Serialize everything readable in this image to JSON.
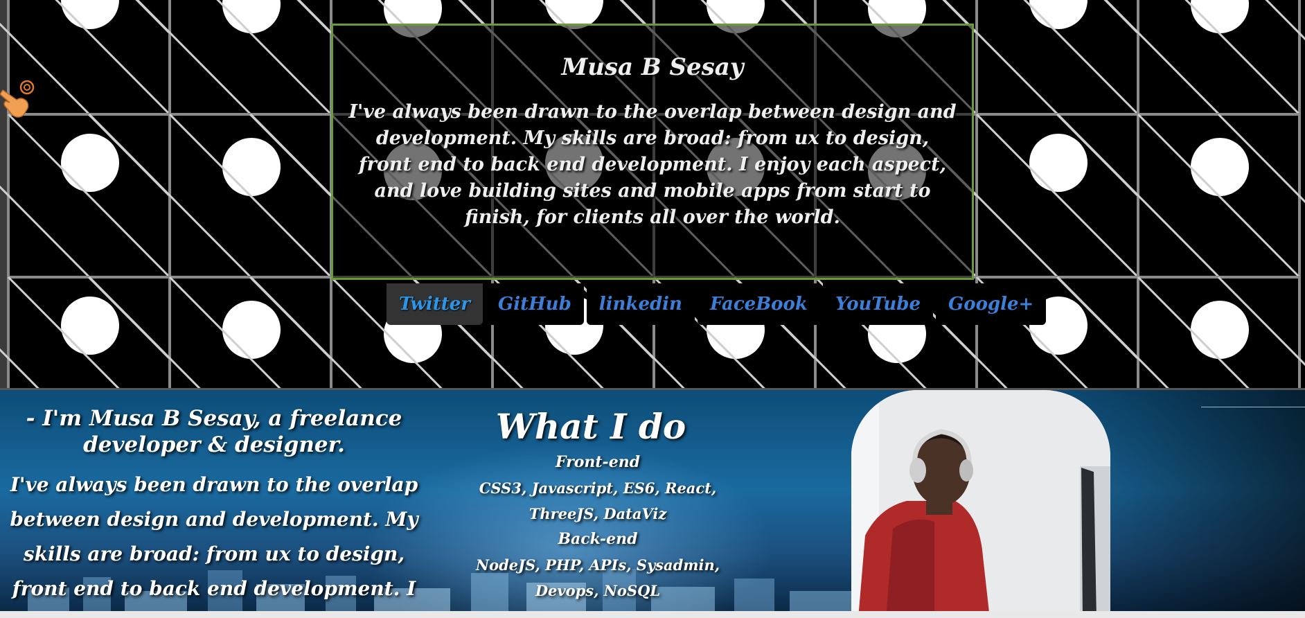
{
  "hero": {
    "name": "Musa B Sesay",
    "bio": "I've always been drawn to the overlap between design and development. My skills are broad: from ux to design, front end to back end development. I enjoy each aspect, and love building sites and mobile apps from start to finish, for clients all over the world."
  },
  "social": [
    {
      "label": "Twitter",
      "active": true
    },
    {
      "label": "GitHub",
      "active": false
    },
    {
      "label": "linkedin",
      "active": false
    },
    {
      "label": "FaceBook",
      "active": false
    },
    {
      "label": "YouTube",
      "active": false
    },
    {
      "label": "Google+",
      "active": false
    }
  ],
  "about": {
    "intro_heading": "- I'm Musa B Sesay, a freelance developer & designer.",
    "intro_text": "I've always been drawn to the overlap between design and development. My skills are broad: from ux to design, front end to back end development. I enjoy each aspect,",
    "what_i_do": {
      "title": "What I do",
      "frontend_title": "Front-end",
      "frontend_list": "CSS3, Javascript, ES6, React, ThreeJS, DataViz",
      "backend_title": "Back-end",
      "backend_list": "NodeJS, PHP, APIs, Sysadmin, Devops, NoSQL"
    }
  },
  "colors": {
    "card_border": "#6a9a35",
    "link": "#3b7fd8",
    "link_active": "#2b95e8",
    "hero_bg": "#000000"
  },
  "icons": [
    "hand-pointer-cursor-icon"
  ]
}
